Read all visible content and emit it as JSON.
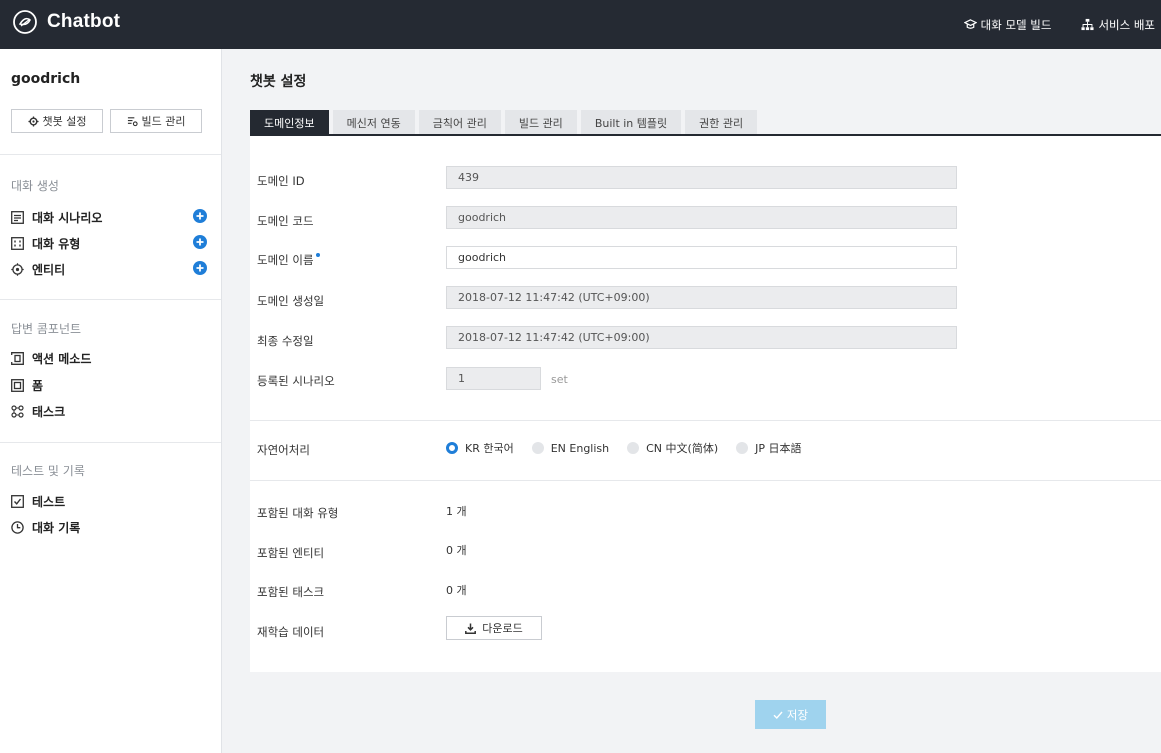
{
  "app": {
    "title": "Chatbot"
  },
  "topbar": {
    "actions": [
      {
        "label": "대화 모델 빌드",
        "icon": "graduation-cap-icon"
      },
      {
        "label": "서비스 배포",
        "icon": "sitemap-icon"
      }
    ]
  },
  "sidebar": {
    "project_name": "goodrich",
    "buttons": {
      "settings": "챗봇 설정",
      "build": "빌드 관리"
    },
    "sections": [
      {
        "title": "대화 생성",
        "items": [
          {
            "label": "대화 시나리오",
            "icon": "scenario-icon"
          },
          {
            "label": "대화 유형",
            "icon": "intent-icon"
          },
          {
            "label": "엔티티",
            "icon": "entity-icon"
          }
        ]
      },
      {
        "title": "답변 콤포넌트",
        "items": [
          {
            "label": "액션 메소드",
            "icon": "action-method-icon"
          },
          {
            "label": "폼",
            "icon": "form-icon"
          },
          {
            "label": "태스크",
            "icon": "task-icon"
          }
        ]
      },
      {
        "title": "테스트 및 기록",
        "items": [
          {
            "label": "테스트",
            "icon": "test-icon"
          },
          {
            "label": "대화 기록",
            "icon": "history-clock-icon"
          }
        ]
      }
    ]
  },
  "main": {
    "title": "챗봇 설정",
    "tabs": [
      "도메인정보",
      "메신저 연동",
      "금칙어 관리",
      "빌드 관리",
      "Built in 템플릿",
      "권한 관리"
    ],
    "fields": {
      "domain_id": {
        "label": "도메인 ID",
        "value": "439"
      },
      "domain_code": {
        "label": "도메인 코드",
        "value": "goodrich"
      },
      "domain_name": {
        "label": "도메인 이름",
        "value": "goodrich"
      },
      "created": {
        "label": "도메인 생성일",
        "value": "2018-07-12 11:47:42 (UTC+09:00)"
      },
      "modified": {
        "label": "최종 수정일",
        "value": "2018-07-12 11:47:42 (UTC+09:00)"
      },
      "scenarios": {
        "label": "등록된 시나리오",
        "value": "1",
        "unit": "set"
      }
    },
    "nlp": {
      "label": "자연어처리",
      "options": [
        "KR 한국어",
        "EN English",
        "CN 中文(简体)",
        "JP 日本語"
      ],
      "selected": "KR 한국어"
    },
    "stats": {
      "intents": {
        "label": "포함된 대화 유형",
        "value": "1 개"
      },
      "entities": {
        "label": "포함된 엔티티",
        "value": "0 개"
      },
      "tasks": {
        "label": "포함된 태스크",
        "value": "0 개"
      }
    },
    "retrain": {
      "label": "재학습 데이터",
      "button": "다운로드"
    },
    "save_label": "저장"
  },
  "colors": {
    "topbar": "#252a33",
    "accent": "#1f7ed8",
    "tab_active": "#242931",
    "save_disabled": "#9fd3ee"
  }
}
